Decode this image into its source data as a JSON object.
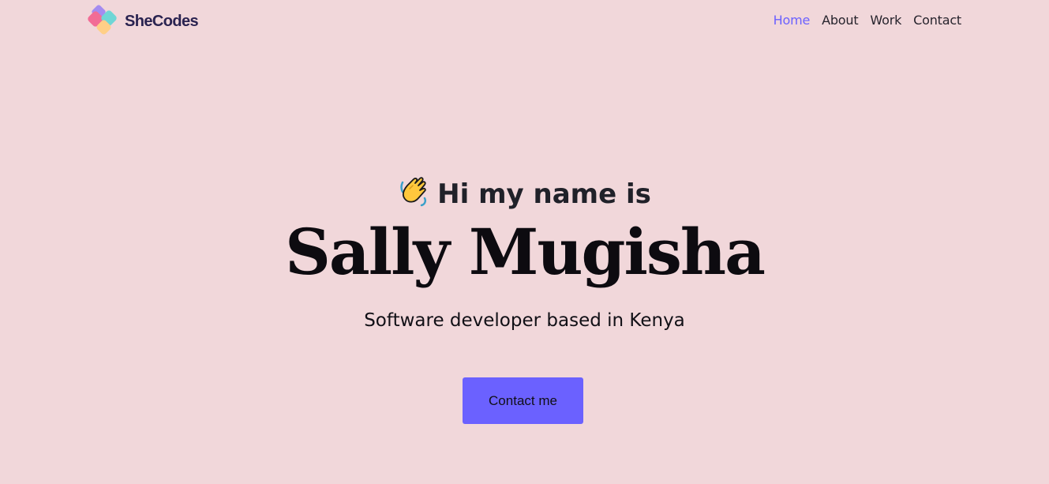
{
  "brand": {
    "name": "SheCodes",
    "logo_icon": "shecodes-logo-icon"
  },
  "nav": {
    "items": [
      {
        "label": "Home",
        "active": true
      },
      {
        "label": "About",
        "active": false
      },
      {
        "label": "Work",
        "active": false
      },
      {
        "label": "Contact",
        "active": false
      }
    ]
  },
  "hero": {
    "greeting_icon": "waving-hand-icon",
    "greeting": "Hi my name is",
    "name": "Sally Mugisha",
    "tagline": "Software developer based in Kenya",
    "cta_label": "Contact me"
  },
  "colors": {
    "background": "#f1d7da",
    "accent": "#6b61ff",
    "text": "#16141f"
  }
}
